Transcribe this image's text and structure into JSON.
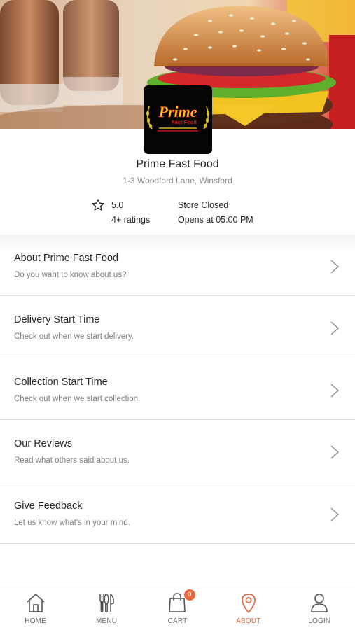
{
  "store": {
    "name": "Prime Fast Food",
    "address": "1-3 Woodford Lane, Winsford",
    "rating": "5.0",
    "ratings_count": "4+ ratings",
    "status": "Store Closed",
    "opens": "Opens at 05:00 PM",
    "logo": {
      "primary": "Prime",
      "secondary": "Fast Food"
    }
  },
  "menu": [
    {
      "title": "About Prime Fast Food",
      "subtitle": "Do you want to know about us?"
    },
    {
      "title": "Delivery Start Time",
      "subtitle": "Check out when we start delivery."
    },
    {
      "title": "Collection Start Time",
      "subtitle": "Check out when we start collection."
    },
    {
      "title": "Our Reviews",
      "subtitle": "Read what others said about us."
    },
    {
      "title": "Give Feedback",
      "subtitle": "Let us know what's in your mind."
    }
  ],
  "tabs": [
    {
      "label": "HOME",
      "icon": "home-icon"
    },
    {
      "label": "MENU",
      "icon": "cutlery-icon"
    },
    {
      "label": "CART",
      "icon": "shopping-bag-icon",
      "badge": "0"
    },
    {
      "label": "ABOUT",
      "icon": "location-pin-icon",
      "active": true
    },
    {
      "label": "LOGIN",
      "icon": "user-icon"
    }
  ],
  "colors": {
    "accent": "#e8683b",
    "logo_yellow": "#f2d21c",
    "logo_red": "#e01818"
  }
}
